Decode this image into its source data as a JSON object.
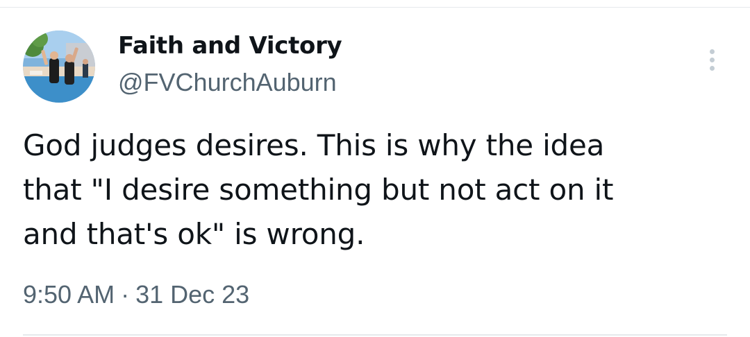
{
  "tweet": {
    "author": {
      "display_name": "Faith and Victory",
      "handle": "@FVChurchAuburn",
      "avatar_icon": "profile-photo-baptism"
    },
    "text": "God judges desires.  This is why the idea\nthat \"I desire something but not act on it\nand that's ok\" is wrong.",
    "time": "9:50 AM",
    "separator": "·",
    "date": "31 Dec 23",
    "more_icon": "more-vertical-icon"
  },
  "colors": {
    "primary_text": "#0f1419",
    "secondary_text": "#536471",
    "divider": "#e6e9ec",
    "more_icon": "#c4cdd4"
  }
}
